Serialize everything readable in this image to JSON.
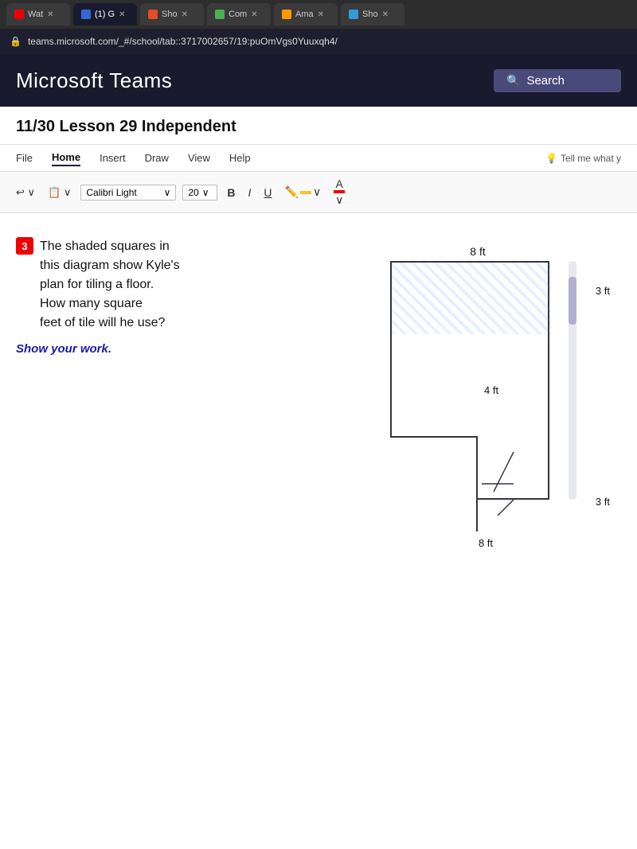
{
  "browser": {
    "tabs": [
      {
        "label": "Wat",
        "icon_color": "#e00",
        "active": false
      },
      {
        "label": "(1) G",
        "icon_color": "#3367d6",
        "active": true
      },
      {
        "label": "Sho",
        "icon_color": "#e44d26",
        "active": false
      },
      {
        "label": "Com",
        "icon_color": "#4caf50",
        "active": false
      },
      {
        "label": "Ama",
        "icon_color": "#ff9900",
        "active": false
      },
      {
        "label": "Sho",
        "icon_color": "#3498db",
        "active": false
      }
    ],
    "address": "teams.microsoft.com/_#/school/tab::3717002657/19:puOmVgs0Yuuxqh4/"
  },
  "teams": {
    "title": "Microsoft Teams",
    "search_placeholder": "Search"
  },
  "document": {
    "lesson_title": "11/30 Lesson 29 Independent",
    "menu": {
      "items": [
        "File",
        "Home",
        "Insert",
        "Draw",
        "View",
        "Help"
      ],
      "active": "Home",
      "tell_me": "Tell me what y"
    },
    "toolbar": {
      "font": "Calibri Light",
      "size": "20",
      "bold": "B",
      "italic": "I",
      "underline": "U"
    }
  },
  "question": {
    "number": "3",
    "text_line1": "The shaded squares in",
    "text_line2": "this diagram show Kyle's",
    "text_line3": "plan for tiling a floor.",
    "text_line4": "How many square",
    "text_line5": "feet of tile will he use?",
    "show_work": "Show your work."
  },
  "diagram": {
    "dim_top": "8 ft",
    "dim_right_top": "3 ft",
    "dim_inner": "4 ft",
    "dim_right_bottom": "3 ft",
    "dim_bottom": "8 ft"
  }
}
